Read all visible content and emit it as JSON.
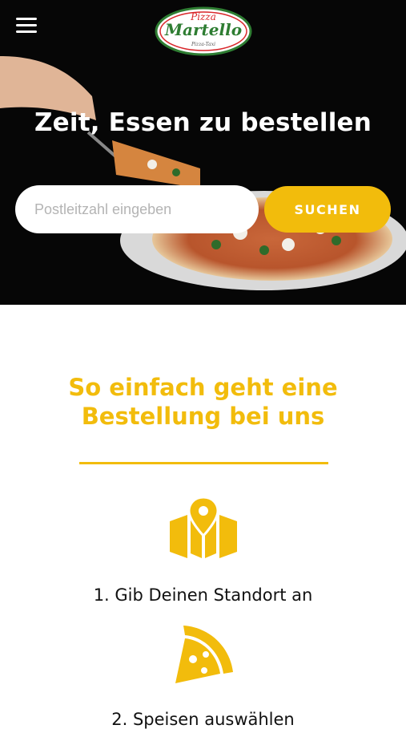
{
  "header": {
    "menu_icon": "hamburger-menu-icon",
    "logo": {
      "top": "Pizza",
      "main": "Martello",
      "bottom": "Pizza-Taxi"
    }
  },
  "hero": {
    "title": "Zeit, Essen zu bestellen",
    "search": {
      "placeholder": "Postleitzahl eingeben",
      "value": ""
    },
    "search_button_label": "SUCHEN"
  },
  "section": {
    "title_line1": "So einfach geht eine",
    "title_line2": "Bestellung bei uns",
    "steps": [
      {
        "label": "1. Gib Deinen Standort an",
        "icon": "map-location-icon"
      },
      {
        "label": "2. Speisen auswählen",
        "icon": "pizza-slice-icon"
      }
    ]
  },
  "colors": {
    "accent": "#f2bc0c",
    "hero_bg": "#050505",
    "text": "#111111"
  }
}
